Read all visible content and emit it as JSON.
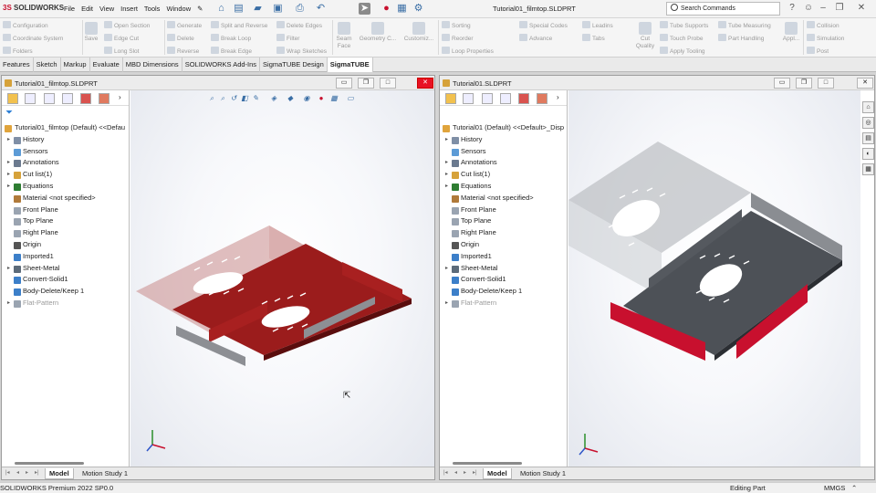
{
  "app": {
    "brand": "SOLIDWORKS",
    "doc_title": "Tutorial01_filmtop.SLDPRT"
  },
  "menus": [
    "File",
    "Edit",
    "View",
    "Insert",
    "Tools",
    "Window"
  ],
  "search": {
    "placeholder": "Search Commands"
  },
  "ribbon": {
    "g1": [
      "Configuration",
      "Coordinate System",
      "Folders"
    ],
    "save": "Save",
    "g2": [
      "Open Section",
      "Edge Cut",
      "Long Slot"
    ],
    "g3": [
      "Generate",
      "Delete",
      "Reverse"
    ],
    "g4": [
      "Split and Reverse",
      "Break Loop",
      "Break Edge"
    ],
    "g5": [
      "Delete Edges",
      "Filter",
      "Wrap Sketches"
    ],
    "seam": "Seam Face",
    "geom": "Geometry C...",
    "custom": "Customiz...",
    "g6": [
      "Sorting",
      "Reorder",
      "Loop Properties"
    ],
    "g7": [
      "Special Codes",
      "Advance"
    ],
    "g8": [
      "Leadins",
      "Tabs"
    ],
    "cutq": "Cut Quality",
    "g9": [
      "Tube Supports",
      "Touch Probe",
      "Apply Tooling"
    ],
    "g10": [
      "Tube Measuring",
      "Part Handling"
    ],
    "appl": "Appl...",
    "g11": [
      "Collision",
      "Simulation",
      "Post"
    ]
  },
  "cm_tabs": [
    "Features",
    "Sketch",
    "Markup",
    "Evaluate",
    "MBD Dimensions",
    "SOLIDWORKS Add-Ins",
    "SigmaTUBE Design",
    "SigmaTUBE"
  ],
  "cm_active": "SigmaTUBE",
  "left_window": {
    "title": "Tutorial01_filmtop.SLDPRT",
    "root": "Tutorial01_filmtop (Default) <<Defau",
    "nodes": [
      "History",
      "Sensors",
      "Annotations",
      "Cut list(1)",
      "Equations",
      "Material <not specified>",
      "Front Plane",
      "Top Plane",
      "Right Plane",
      "Origin",
      "Imported1",
      "Sheet-Metal",
      "Convert-Solid1",
      "Body-Delete/Keep 1",
      "Flat-Pattern"
    ]
  },
  "right_window": {
    "title": "Tutorial01.SLDPRT",
    "root": "Tutorial01 (Default) <<Default>_Disp",
    "nodes": [
      "History",
      "Sensors",
      "Annotations",
      "Cut list(1)",
      "Equations",
      "Material <not specified>",
      "Front Plane",
      "Top Plane",
      "Right Plane",
      "Origin",
      "Imported1",
      "Sheet-Metal",
      "Convert-Solid1",
      "Body-Delete/Keep 1",
      "Flat-Pattern"
    ]
  },
  "bottom_tabs": [
    "Model",
    "Motion Study 1"
  ],
  "status": {
    "left": "SOLIDWORKS Premium 2022 SP0.0",
    "editing": "Editing Part",
    "units": "MMGS"
  },
  "colors": {
    "brand_red": "#c8102e",
    "part_red": "#9b1c1c",
    "part_gray": "#4d5157",
    "close": "#e81123"
  }
}
